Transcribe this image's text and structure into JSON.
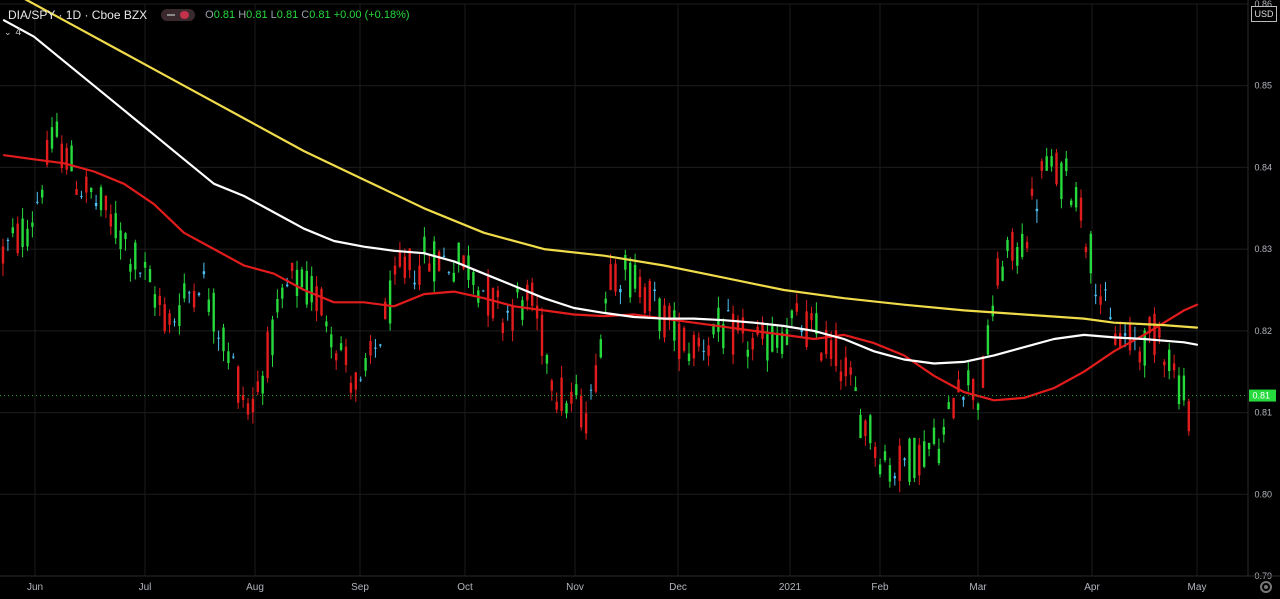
{
  "header": {
    "symbol": "DIA/SPY · 1D · Cboe BZX",
    "ohlc_o_label": "O",
    "ohlc_o": "0.81",
    "ohlc_h_label": "H",
    "ohlc_h": "0.81",
    "ohlc_l_label": "L",
    "ohlc_l": "0.81",
    "ohlc_c_label": "C",
    "ohlc_c": "0.81",
    "change": "+0.00 (+0.18%)"
  },
  "indicator_count": "4",
  "currency": "USD",
  "colors": {
    "background": "#000000",
    "up": "#26d93c",
    "down": "#e21c1c",
    "doji": "#4fc3f7",
    "ma_red": "#e21c1c",
    "ma_white": "#ffffff",
    "ma_yellow": "#f0dc4a",
    "last_price_tag": "#26d93c"
  },
  "chart_data": {
    "type": "candlestick",
    "ylim": [
      0.79,
      0.86
    ],
    "y_ticks": [
      "0.86",
      "0.85",
      "0.84",
      "0.83",
      "0.82",
      "0.81",
      "0.80",
      "0.79"
    ],
    "x_ticks": [
      "Jun",
      "Jul",
      "Aug",
      "Sep",
      "Oct",
      "Nov",
      "Dec",
      "2021",
      "Feb",
      "Mar",
      "Apr",
      "May"
    ],
    "last_price": "0.81",
    "series": [
      {
        "color": "#e21c1c",
        "values": [
          0.8415,
          0.841,
          0.8405,
          0.8395,
          0.838,
          0.8355,
          0.832,
          0.83,
          0.828,
          0.827,
          0.825,
          0.8235,
          0.8235,
          0.823,
          0.8245,
          0.8248,
          0.824,
          0.823,
          0.8225,
          0.822,
          0.8218,
          0.822,
          0.8215,
          0.821,
          0.8205,
          0.82,
          0.8195,
          0.819,
          0.8195,
          0.8185,
          0.817,
          0.8145,
          0.8125,
          0.8115,
          0.8118,
          0.813,
          0.815,
          0.8175,
          0.8195,
          0.821,
          0.8225,
          0.8232
        ]
      },
      {
        "color": "#ffffff",
        "values": [
          0.858,
          0.856,
          0.853,
          0.85,
          0.847,
          0.844,
          0.841,
          0.838,
          0.8365,
          0.8345,
          0.8325,
          0.831,
          0.8303,
          0.8298,
          0.8295,
          0.8285,
          0.827,
          0.8255,
          0.824,
          0.8228,
          0.8222,
          0.8217,
          0.8215,
          0.8215,
          0.8213,
          0.821,
          0.8206,
          0.82,
          0.819,
          0.8175,
          0.8165,
          0.816,
          0.8162,
          0.817,
          0.818,
          0.819,
          0.8195,
          0.8192,
          0.819,
          0.8188,
          0.8186,
          0.8183
        ]
      },
      {
        "color": "#f0dc4a",
        "values": [
          0.862,
          0.858,
          0.854,
          0.85,
          0.846,
          0.842,
          0.8385,
          0.835,
          0.832,
          0.83,
          0.8292,
          0.828,
          0.8265,
          0.825,
          0.824,
          0.8232,
          0.8225,
          0.822,
          0.8215,
          0.821,
          0.8207,
          0.8204
        ]
      }
    ]
  }
}
